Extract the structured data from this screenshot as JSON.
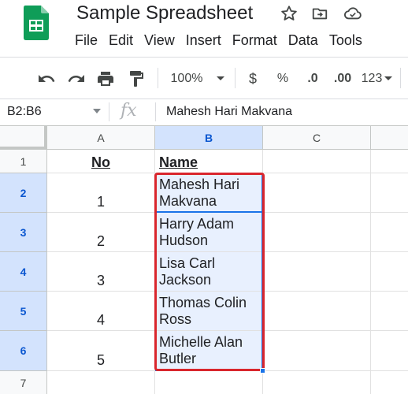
{
  "app": {
    "title": "Sample Spreadsheet",
    "icons": [
      "star-icon",
      "move-to-folder-icon",
      "cloud-status-icon"
    ],
    "menu": [
      "File",
      "Edit",
      "View",
      "Insert",
      "Format",
      "Data",
      "Tools"
    ]
  },
  "toolbar": {
    "zoom": "100%",
    "currency": "$",
    "percent": "%",
    "decrease_decimals": ".0",
    "increase_decimals": ".00",
    "more_formats": "123"
  },
  "formula_bar": {
    "name_box": "B2:B6",
    "fx": "fx",
    "value": "Mahesh Hari Makvana"
  },
  "sheet": {
    "columns": [
      "A",
      "B",
      "C"
    ],
    "rows": [
      "1",
      "2",
      "3",
      "4",
      "5",
      "6",
      "7"
    ],
    "headers": {
      "no": "No",
      "name": "Name"
    },
    "data": [
      {
        "no": "1",
        "name": "Mahesh Hari Makvana"
      },
      {
        "no": "2",
        "name": "Harry Adam Hudson"
      },
      {
        "no": "3",
        "name": "Lisa Carl Jackson"
      },
      {
        "no": "4",
        "name": "Thomas Colin Ross"
      },
      {
        "no": "5",
        "name": "Michelle Alan Butler"
      }
    ]
  },
  "colors": {
    "selection": "#1a73e8",
    "selection_fill": "#e8f0fe",
    "highlight_box": "#d9262d",
    "sheets_green": "#0f9d58"
  }
}
